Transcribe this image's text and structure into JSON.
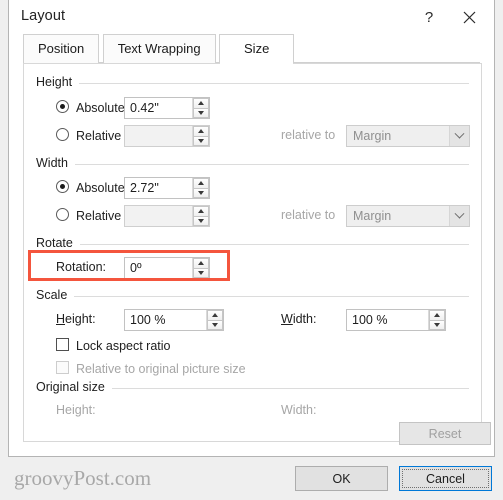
{
  "window": {
    "title": "Layout",
    "help_icon": "question-mark-icon",
    "close_icon": "close-icon"
  },
  "tabs": [
    {
      "label": "Position",
      "active": false
    },
    {
      "label": "Text Wrapping",
      "active": false
    },
    {
      "label": "Size",
      "active": true
    }
  ],
  "height_group": {
    "title": "Height",
    "absolute_label": "Absolute",
    "absolute_value": "0.42\"",
    "absolute_selected": true,
    "relative_label": "Relative",
    "relative_value": "",
    "relative_to_label": "relative to",
    "relative_to_value": "Margin"
  },
  "width_group": {
    "title": "Width",
    "absolute_label": "Absolute",
    "absolute_value": "2.72\"",
    "absolute_selected": true,
    "relative_label": "Relative",
    "relative_value": "",
    "relative_to_label": "relative to",
    "relative_to_value": "Margin"
  },
  "rotate_group": {
    "title": "Rotate",
    "rotation_label": "Rotation:",
    "rotation_value": "0º",
    "highlight_color": "#f4553d"
  },
  "scale_group": {
    "title": "Scale",
    "height_label": "Height:",
    "height_value": "100 %",
    "width_label": "Width:",
    "width_value": "100 %",
    "lock_aspect_label": "Lock aspect ratio",
    "lock_aspect_checked": false,
    "relative_original_label": "Relative to original picture size",
    "relative_original_checked": false
  },
  "original_size_group": {
    "title": "Original size",
    "height_label": "Height:",
    "height_value": "",
    "width_label": "Width:",
    "width_value": "",
    "reset_label": "Reset"
  },
  "buttons": {
    "ok_label": "OK",
    "cancel_label": "Cancel"
  },
  "watermark": "groovyPost.com"
}
